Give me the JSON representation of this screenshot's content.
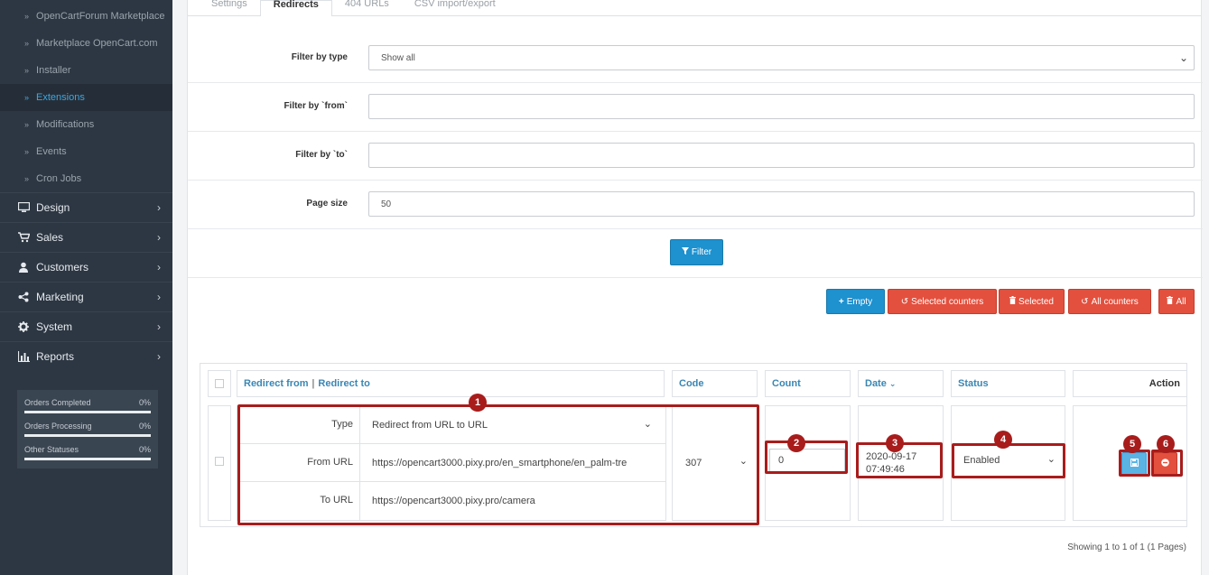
{
  "sidebar": {
    "sub_items": [
      {
        "label": "OpenCartForum Marketplace",
        "active": false
      },
      {
        "label": "Marketplace OpenCart.com",
        "active": false
      },
      {
        "label": "Installer",
        "active": false
      },
      {
        "label": "Extensions",
        "active": true
      },
      {
        "label": "Modifications",
        "active": false
      },
      {
        "label": "Events",
        "active": false
      },
      {
        "label": "Cron Jobs",
        "active": false
      }
    ],
    "main_items": [
      {
        "label": "Design",
        "icon": "desktop-icon"
      },
      {
        "label": "Sales",
        "icon": "cart-icon"
      },
      {
        "label": "Customers",
        "icon": "user-icon"
      },
      {
        "label": "Marketing",
        "icon": "share-icon"
      },
      {
        "label": "System",
        "icon": "gear-icon"
      },
      {
        "label": "Reports",
        "icon": "bar-chart-icon"
      }
    ],
    "stats": [
      {
        "label": "Orders Completed",
        "value": "0%",
        "progress": 0
      },
      {
        "label": "Orders Processing",
        "value": "0%",
        "progress": 0
      },
      {
        "label": "Other Statuses",
        "value": "0%",
        "progress": 0
      }
    ]
  },
  "tabs": [
    "Settings",
    "Redirects",
    "404 URLs",
    "CSV import/export"
  ],
  "active_tab": "Redirects",
  "filters": {
    "type_label": "Filter by type",
    "type_value": "Show all",
    "from_label": "Filter by `from`",
    "from_value": "",
    "to_label": "Filter by `to`",
    "to_value": "",
    "page_size_label": "Page size",
    "page_size_value": "50",
    "filter_button": "Filter"
  },
  "actions": {
    "empty": "Empty",
    "selected_counters": "Selected counters",
    "selected": "Selected",
    "all_counters": "All counters",
    "all": "All"
  },
  "table": {
    "headers": {
      "redirect_from": "Redirect from",
      "separator": "|",
      "redirect_to": "Redirect to",
      "code": "Code",
      "count": "Count",
      "date": "Date",
      "status": "Status",
      "action": "Action"
    },
    "row": {
      "type_label": "Type",
      "type_value": "Redirect from URL to URL",
      "from_label": "From URL",
      "from_value": "https://opencart3000.pixy.pro/en_smartphone/en_palm-tre",
      "to_label": "To URL",
      "to_value": "https://opencart3000.pixy.pro/camera",
      "code": "307",
      "count": "0",
      "date_line1": "2020-09-17",
      "date_line2": "07:49:46",
      "status": "Enabled"
    }
  },
  "badges": [
    "1",
    "2",
    "3",
    "4",
    "5",
    "6"
  ],
  "pagination_text": "Showing 1 to 1 of 1 (1 Pages)",
  "colors": {
    "sidebar_bg": "#2d3743",
    "accent_blue": "#1e91cf",
    "danger_red": "#e3503e",
    "annotation": "#a81c1c",
    "link_blue": "#3a86b4"
  }
}
